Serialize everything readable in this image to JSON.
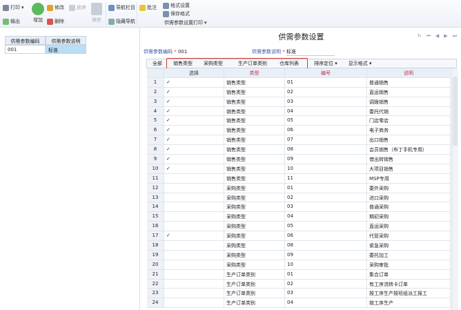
{
  "toolbar": {
    "print": "打印",
    "export": "输出",
    "add": "增加",
    "modify": "修改",
    "abandon": "放弃",
    "delete": "删除",
    "save": "保存",
    "nav_column": "导航栏目",
    "hide_nav": "隐藏导航",
    "annotate": "批注",
    "format_settings": "格式设置",
    "save_format": "保存格式",
    "print_settings": "供需参数设置打印"
  },
  "left": {
    "headers": [
      "供需参数编码",
      "供需参数说明"
    ],
    "rows": [
      [
        "001",
        "标准"
      ]
    ]
  },
  "main": {
    "title": "供需参数设置",
    "code_label": "供需参数编码",
    "code_value": "001",
    "desc_label": "供需参数说明",
    "desc_value": "标准",
    "tabs": [
      "全部",
      "销售类型",
      "采购类型",
      "生产订单类别",
      "仓库列表"
    ],
    "sort": "排序定位",
    "display": "显示格式",
    "headers": [
      "",
      "选择",
      "类型",
      "编号",
      "说明"
    ],
    "rows": [
      [
        "1",
        "✓",
        "销售类型",
        "01",
        "普通销售"
      ],
      [
        "2",
        "✓",
        "销售类型",
        "02",
        "直运销售"
      ],
      [
        "3",
        "✓",
        "销售类型",
        "03",
        "调拨销售"
      ],
      [
        "4",
        "✓",
        "销售类型",
        "04",
        "委托代销"
      ],
      [
        "5",
        "✓",
        "销售类型",
        "05",
        "门店零店"
      ],
      [
        "6",
        "✓",
        "销售类型",
        "06",
        "电子商务"
      ],
      [
        "7",
        "✓",
        "销售类型",
        "07",
        "出口销售"
      ],
      [
        "8",
        "✓",
        "销售类型",
        "08",
        "会员销售（布丁手机专用）"
      ],
      [
        "9",
        "✓",
        "销售类型",
        "09",
        "借出转销售"
      ],
      [
        "10",
        "✓",
        "销售类型",
        "10",
        "大项目销售"
      ],
      [
        "11",
        "",
        "销售类型",
        "11",
        "MSP专用"
      ],
      [
        "12",
        "",
        "采购类型",
        "01",
        "委外采购"
      ],
      [
        "13",
        "",
        "采购类型",
        "02",
        "进口采购"
      ],
      [
        "14",
        "",
        "采购类型",
        "03",
        "普通采购"
      ],
      [
        "15",
        "",
        "采购类型",
        "04",
        "期初采购"
      ],
      [
        "16",
        "",
        "采购类型",
        "05",
        "直运采购"
      ],
      [
        "17",
        "✓",
        "采购类型",
        "06",
        "代管采购"
      ],
      [
        "18",
        "",
        "采购类型",
        "08",
        "紧急采购"
      ],
      [
        "19",
        "",
        "采购类型",
        "09",
        "委托加工"
      ],
      [
        "20",
        "",
        "采购类型",
        "10",
        "采购审批"
      ],
      [
        "21",
        "",
        "生产订单类别",
        "01",
        "集合订单"
      ],
      [
        "22",
        "",
        "生产订单类别",
        "02",
        "有工序流转卡订单"
      ],
      [
        "23",
        "",
        "生产订单类别",
        "03",
        "按工序生产按班组派工报工"
      ],
      [
        "24",
        "",
        "生产订单类别",
        "04",
        "按工序生产"
      ]
    ]
  }
}
